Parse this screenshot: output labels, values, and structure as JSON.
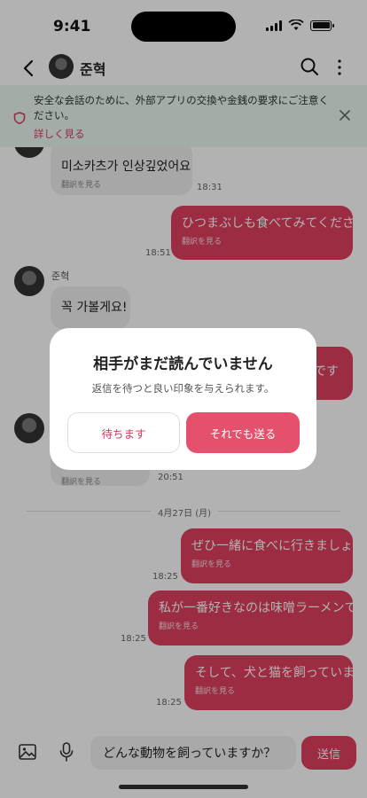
{
  "status": {
    "time": "9:41"
  },
  "header": {
    "contact_name": "준혁"
  },
  "notice": {
    "text": "安全な会話のために、外部アプリの交換や金銭の要求にご注意ください。",
    "link": "詳しく見る"
  },
  "messages": [
    {
      "dir": "in",
      "text": "미소카츠가 인상깊었어요",
      "sub": "翻訳を見る",
      "time": "18:31"
    },
    {
      "dir": "out",
      "text": "ひつまぶしも食べてみてください",
      "sub": "翻訳を見る",
      "time": "18:51"
    },
    {
      "dir": "in",
      "sender": "준혁",
      "text": "꼭 가볼게요!",
      "sub": "",
      "time": ""
    },
    {
      "dir": "out",
      "text": "です",
      "sub": "",
      "time": ""
    },
    {
      "dir": "in",
      "text": "",
      "sub": "翻訳を見る",
      "time": "20:51"
    },
    {
      "dir": "out",
      "text": "ぜひ一緒に食べに行きましょう",
      "sub": "翻訳を見る",
      "time": "18:25"
    },
    {
      "dir": "out",
      "text": "私が一番好きなのは味噌ラーメンです",
      "sub": "翻訳を見る",
      "time": "18:25"
    },
    {
      "dir": "out",
      "text": "そして、犬と猫を飼っています",
      "sub": "翻訳を見る",
      "time": "18:25"
    }
  ],
  "date_divider": "4月27日 (月)",
  "input": {
    "value": "どんな動物を飼っていますか？",
    "send_label": "送信"
  },
  "modal": {
    "title": "相手がまだ読んでいません",
    "description": "返信を待つと良い印象を与えられます。",
    "wait_label": "待ちます",
    "send_anyway_label": "それでも送る"
  },
  "colors": {
    "accent": "#de3f5e",
    "notice_bg": "#eaf7f0"
  }
}
